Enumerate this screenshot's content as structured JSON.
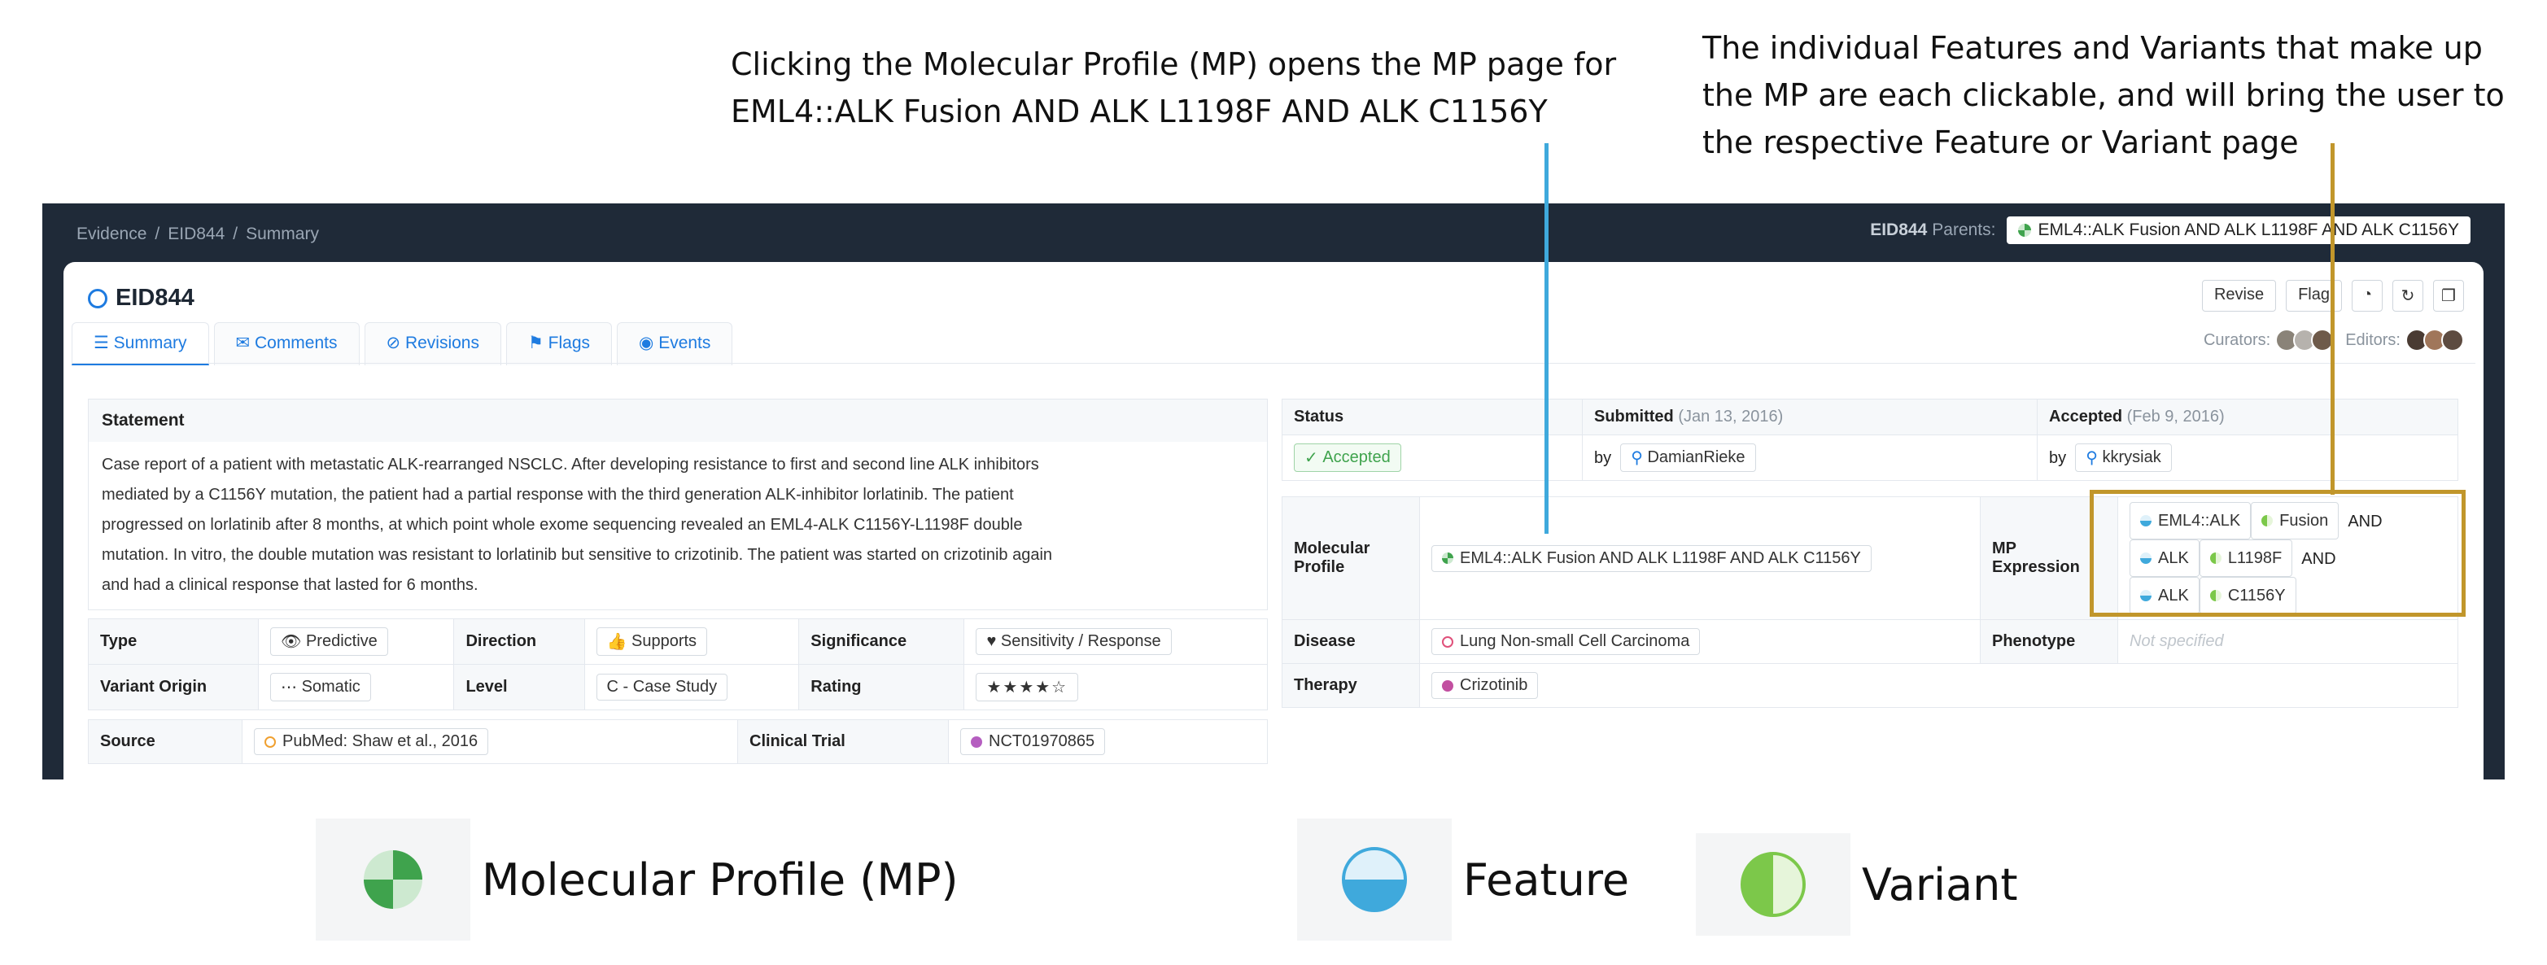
{
  "callouts": {
    "mp": [
      "Clicking the Molecular Profile (MP) opens the MP page for",
      "EML4::ALK Fusion AND ALK L1198F AND ALK C1156Y"
    ],
    "features": [
      "The individual Features and Variants that make up",
      "the MP are each clickable, and will bring the user to",
      "the respective Feature or Variant page"
    ]
  },
  "breadcrumb": [
    "Evidence",
    "EID844",
    "Summary"
  ],
  "parents": {
    "id": "EID844",
    "label": "Parents:",
    "mp": "EML4::ALK Fusion AND ALK L1198F AND ALK C1156Y"
  },
  "title": "EID844",
  "tabs": [
    "Summary",
    "Comments",
    "Revisions",
    "Flags",
    "Events"
  ],
  "actions": {
    "revise": "Revise",
    "flag": "Flag"
  },
  "people": {
    "curators": "Curators:",
    "editors": "Editors:"
  },
  "statement": {
    "label": "Statement",
    "lines": [
      "Case report of a patient with metastatic ALK-rearranged NSCLC. After developing resistance to first and second line ALK inhibitors",
      "mediated by a C1156Y mutation, the patient had a partial response with the third generation ALK-inhibitor lorlatinib. The patient",
      "progressed on lorlatinib after 8 months, at which point whole exome sequencing revealed an EML4-ALK C1156Y-L1198F double",
      "mutation. In vitro, the double mutation was resistant to lorlatinib but sensitive to crizotinib. The patient was started on crizotinib again",
      "and had a clinical response that lasted for 6 months."
    ]
  },
  "attrs": {
    "type_k": "Type",
    "type_v": "Predictive",
    "direction_k": "Direction",
    "direction_v": "Supports",
    "significance_k": "Significance",
    "significance_v": "Sensitivity / Response",
    "origin_k": "Variant Origin",
    "origin_v": "Somatic",
    "level_k": "Level",
    "level_v": "C - Case Study",
    "rating_k": "Rating",
    "rating_v": "★★★★☆",
    "source_k": "Source",
    "source_v": "PubMed: Shaw et al., 2016",
    "trial_k": "Clinical Trial",
    "trial_v": "NCT01970865"
  },
  "status": {
    "status_k": "Status",
    "status_v": "Accepted",
    "submitted_k": "Submitted",
    "submitted_date": "(Jan 13, 2016)",
    "by": "by",
    "submitted_by": "DamianRieke",
    "accepted_k": "Accepted",
    "accepted_date": "(Feb 9, 2016)",
    "accepted_by": "kkrysiak"
  },
  "mp": {
    "mp_k": "Molecular Profile",
    "mp_v": "EML4::ALK Fusion AND ALK L1198F AND ALK C1156Y",
    "expr_k": "MP Expression",
    "expr": [
      {
        "feature": "EML4::ALK",
        "variant": "Fusion",
        "op": "AND"
      },
      {
        "feature": "ALK",
        "variant": "L1198F",
        "op": "AND"
      },
      {
        "feature": "ALK",
        "variant": "C1156Y",
        "op": ""
      }
    ],
    "disease_k": "Disease",
    "disease_v": "Lung Non-small Cell Carcinoma",
    "phenotype_k": "Phenotype",
    "phenotype_v": "Not specified",
    "therapy_k": "Therapy",
    "therapy_v": "Crizotinib"
  },
  "legend": {
    "mp": "Molecular Profile (MP)",
    "feature": "Feature",
    "variant": "Variant"
  },
  "colors": {
    "accent": "#1e7be0",
    "callout_line_blue": "#3fa9dc",
    "callout_line_gold": "#c1962b",
    "mp_green": "#3fa34d",
    "feature_blue": "#3fa9dc",
    "variant_green": "#7cc84a"
  }
}
